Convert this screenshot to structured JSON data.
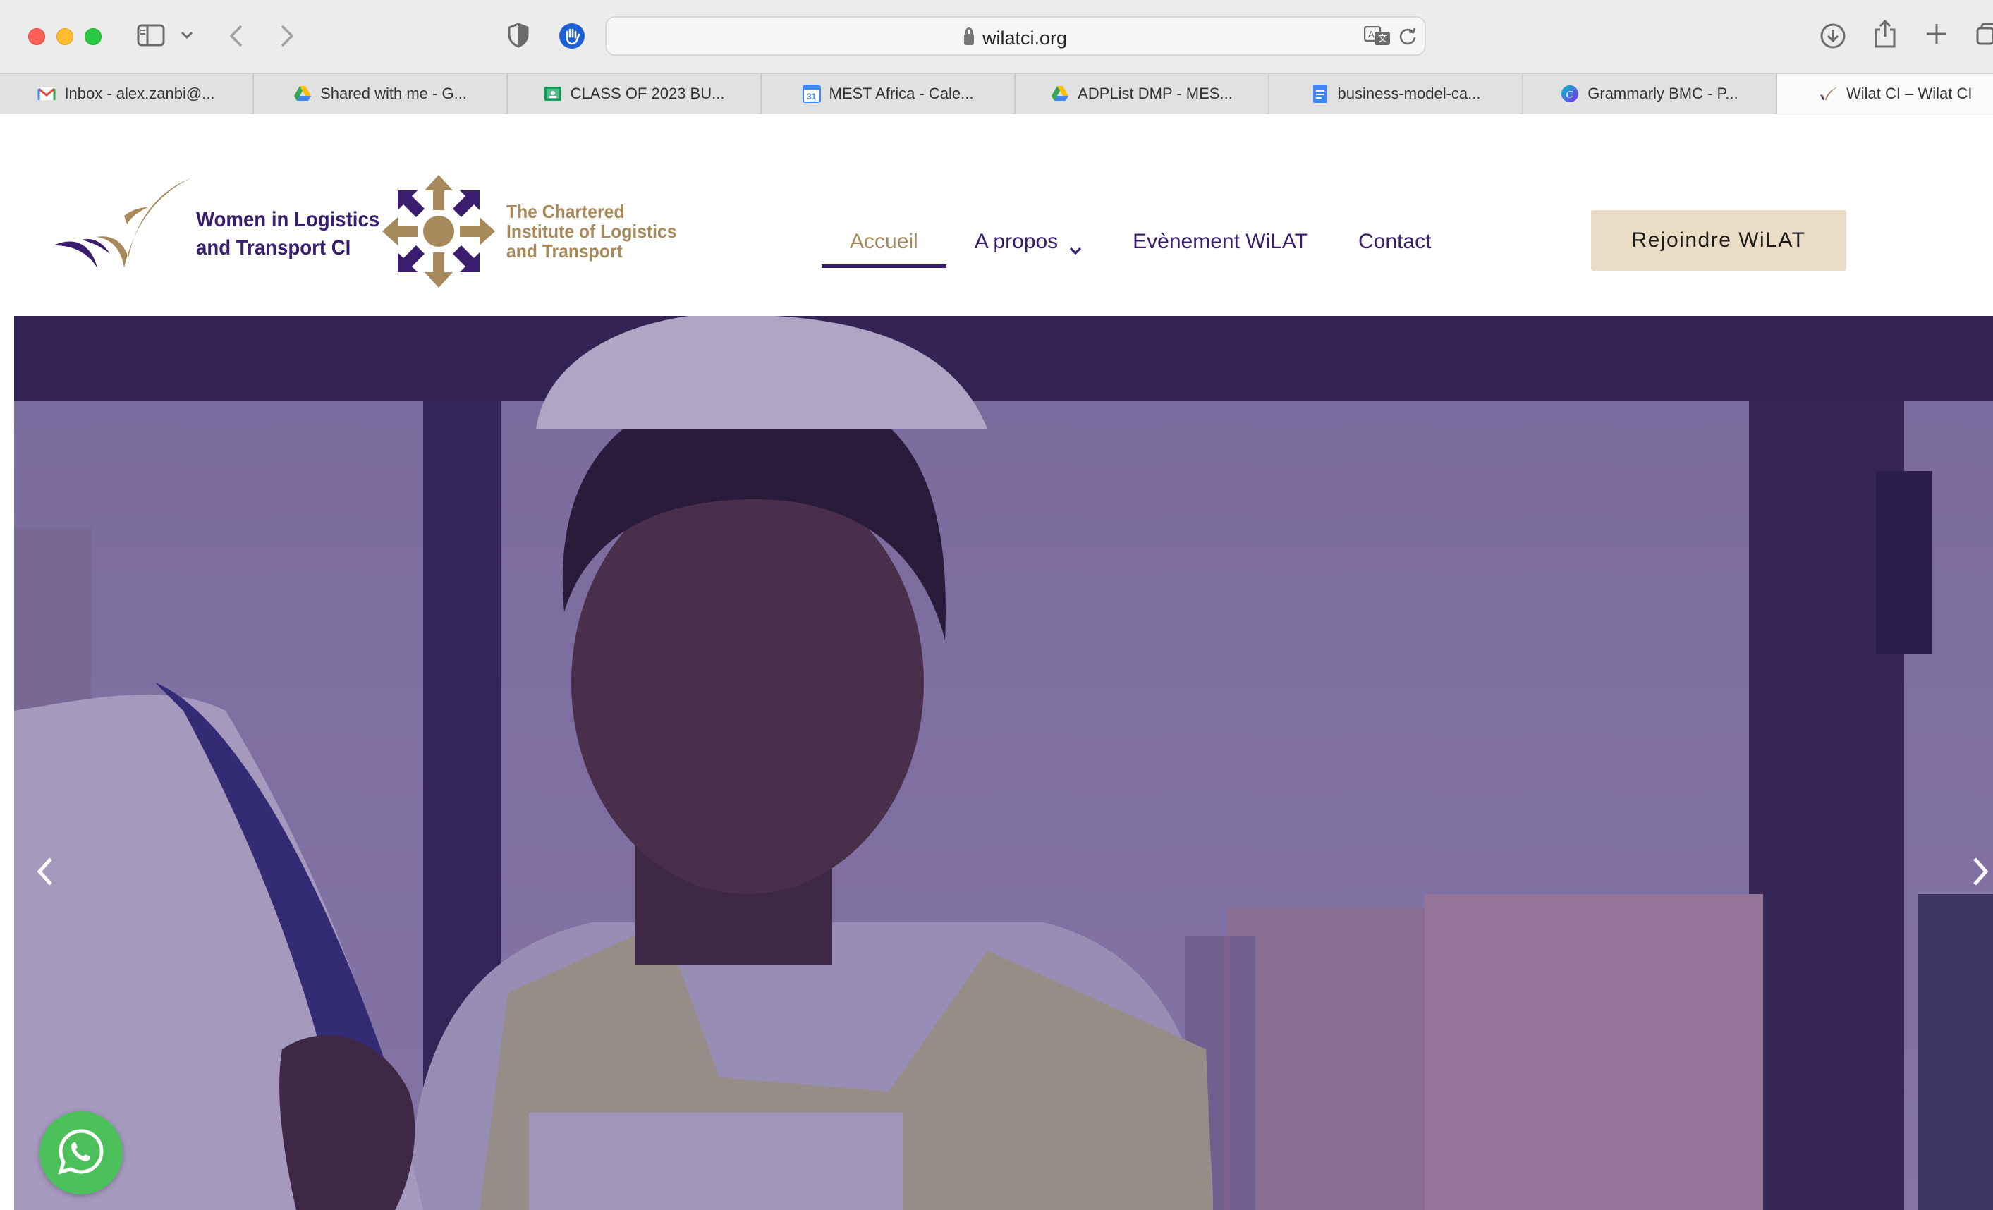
{
  "browser": {
    "url": "wilatci.org",
    "tabs": [
      {
        "label": "Inbox - alex.zanbi@...",
        "icon": "gmail-icon"
      },
      {
        "label": "Shared with me - G...",
        "icon": "google-drive-icon"
      },
      {
        "label": "CLASS OF 2023 BU...",
        "icon": "google-classroom-icon"
      },
      {
        "label": "MEST Africa - Cale...",
        "icon": "google-calendar-icon"
      },
      {
        "label": "ADPList DMP - MES...",
        "icon": "google-drive-icon"
      },
      {
        "label": "business-model-ca...",
        "icon": "google-docs-icon"
      },
      {
        "label": "Grammarly BMC - P...",
        "icon": "canva-icon"
      },
      {
        "label": "Wilat CI – Wilat CI",
        "icon": "wilat-logo-icon",
        "active": true
      }
    ]
  },
  "header": {
    "logo_text_line1": "Women in Logistics",
    "logo_text_line2": "and Transport CI",
    "cilt_line1": "The Chartered",
    "cilt_line2": "Institute of Logistics",
    "cilt_line3": "and Transport",
    "nav": [
      {
        "label": "Accueil",
        "active": true
      },
      {
        "label": "A propos",
        "has_dropdown": true
      },
      {
        "label": "Evènement WiLAT"
      },
      {
        "label": "Contact"
      }
    ],
    "cta_label": "Rejoindre WiLAT"
  },
  "colors": {
    "brand_purple": "#3a1d6e",
    "brand_gold": "#a68a5c",
    "cta_background": "#ebdcc5",
    "hero_overlay": "#4b2e83",
    "whatsapp_green": "#4cc05b"
  },
  "hero": {
    "image": "woman-in-hard-hat-with-tablet-at-container-port",
    "controls": [
      "chevron-left-icon",
      "chevron-right-icon"
    ]
  },
  "floating": {
    "icon": "whatsapp-icon"
  }
}
